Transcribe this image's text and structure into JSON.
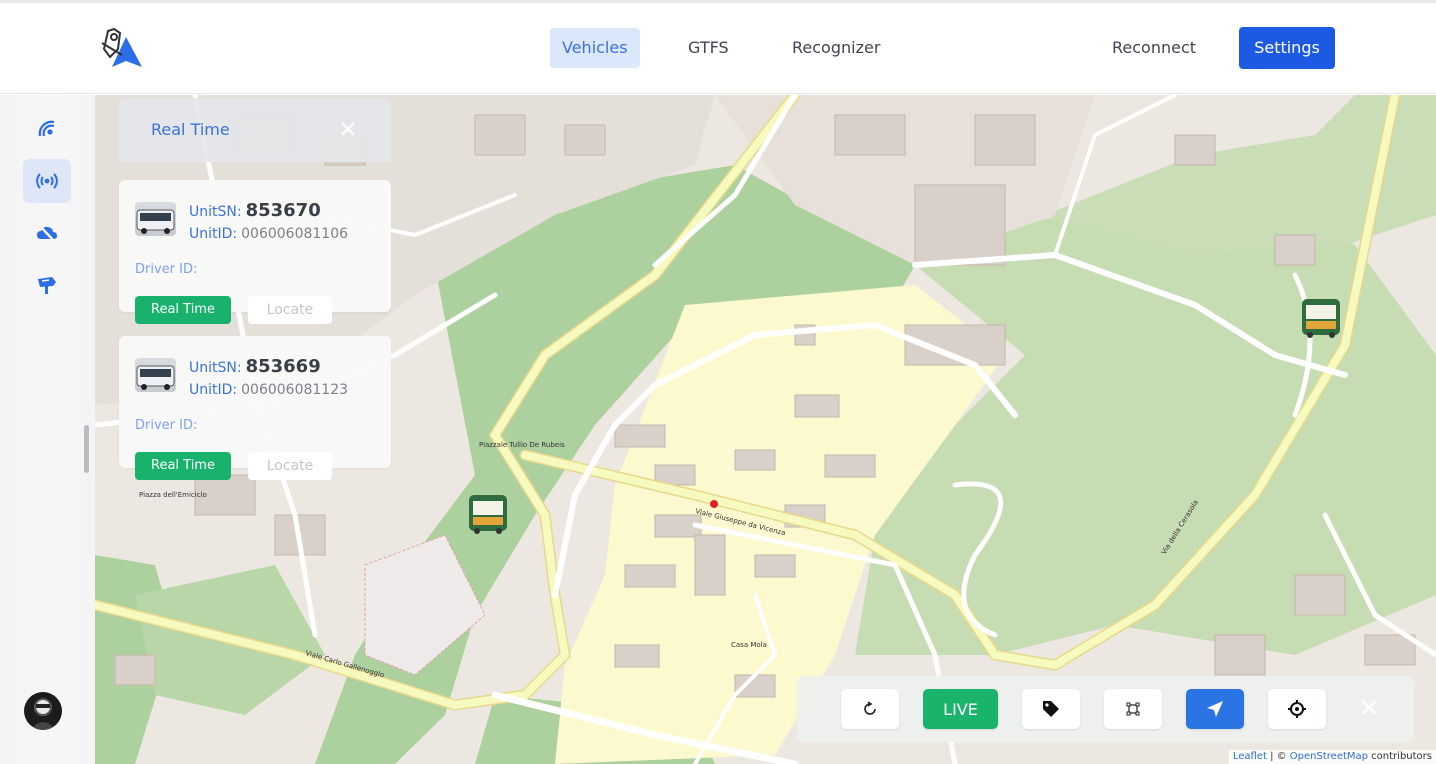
{
  "header": {
    "tabs": [
      {
        "label": "Vehicles",
        "active": true
      },
      {
        "label": "GTFS",
        "active": false
      },
      {
        "label": "Recognizer",
        "active": false
      }
    ],
    "reconnect_label": "Reconnect",
    "settings_label": "Settings"
  },
  "sidebar": {
    "items": [
      {
        "icon": "satellite-dish-icon",
        "active": false
      },
      {
        "icon": "broadcast-icon",
        "active": true
      },
      {
        "icon": "cloud-off-icon",
        "active": false
      },
      {
        "icon": "route-sign-icon",
        "active": false
      }
    ]
  },
  "realtime_panel": {
    "title": "Real Time",
    "vehicles": [
      {
        "unitsn_label": "UnitSN:",
        "unitsn": "853670",
        "unitid_label": "UnitID:",
        "unitid": "006006081106",
        "driver_label": "Driver ID:",
        "realtime_label": "Real Time",
        "locate_label": "Locate"
      },
      {
        "unitsn_label": "UnitSN:",
        "unitsn": "853669",
        "unitid_label": "UnitID:",
        "unitid": "006006081123",
        "driver_label": "Driver ID:",
        "realtime_label": "Real Time",
        "locate_label": "Locate"
      }
    ]
  },
  "map": {
    "labels": {
      "road1": "Viale Giuseppe da Vicenza",
      "road2": "Viale Carlo Gallenoggio",
      "road3": "Via della Cerasola",
      "place1": "Piazzale Tullio De Rubeis",
      "place2": "Casa Mola",
      "place3": "Piazza dell'Emiciclo"
    },
    "attribution": {
      "leaflet": "Leaflet",
      "sep": " | © ",
      "osm": "OpenStreetMap",
      "suffix": " contributors"
    }
  },
  "toolbar": {
    "live_label": "LIVE",
    "buttons": [
      "refresh-icon",
      "tag-icon",
      "select-area-icon",
      "navigation-arrow-icon",
      "crosshair-icon"
    ]
  },
  "colors": {
    "accent": "#1d5ae3",
    "live": "#18b26c",
    "map_green": "#add19e",
    "map_residential": "#fdf9cf"
  }
}
